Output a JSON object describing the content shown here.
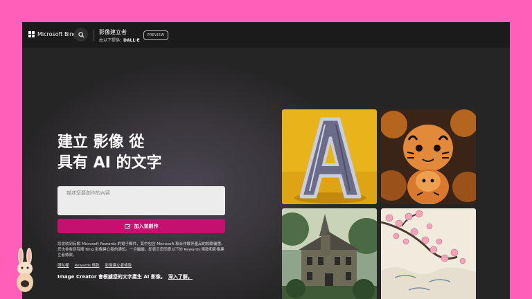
{
  "topbar": {
    "brand": "Microsoft Bing",
    "title": "影像建立者",
    "provided_by_label": "由以下提供:",
    "provided_by_value": "DALL·E",
    "preview_badge": "PREVIEW"
  },
  "hero": {
    "headline_line1": "建立 影像 從",
    "headline_line2": "具有 AI 的文字",
    "prompt_placeholder": "描述您要創作的內容",
    "prompt_value": "",
    "create_button": "加入並創作",
    "terms_text": "您會收到有關 Microsoft Rewards 的電子郵件，其中包含 Microsoft 和合作夥伴產品的相關優惠。您也會收到有關 Bing 影像建立者的通知。一旦繼續，即表示您同意以下的 Rewards 條款和影像建立者條款。",
    "links": [
      "隱私權",
      "Rewards 條款",
      "影像建立者條款"
    ],
    "info_text": "Image Creator 會根據您的文字產生 AI 影像。",
    "learn_more": "深入了解。"
  },
  "gallery": {
    "images": [
      "letter-a-image",
      "tiger-figurines-image",
      "mansion-forest-image",
      "cherry-blossom-image"
    ]
  },
  "colors": {
    "page_border": "#ff5fb8",
    "accent": "#c4106f",
    "topbar": "#1b1b1b"
  }
}
